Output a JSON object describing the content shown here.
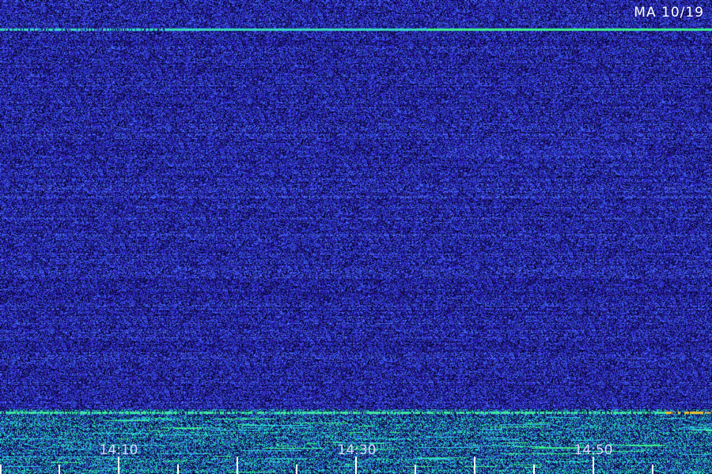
{
  "header": {
    "station_date": "MA 10/19"
  },
  "time_axis": {
    "labels": [
      "14:10",
      "14:30",
      "14:50"
    ]
  },
  "colors": {
    "background": "#0a0630",
    "noise": "#3a2ee0",
    "strong_signal": "#2ee8a0",
    "label_text": "#ffffff",
    "amber_marker": "#e8c030"
  }
}
